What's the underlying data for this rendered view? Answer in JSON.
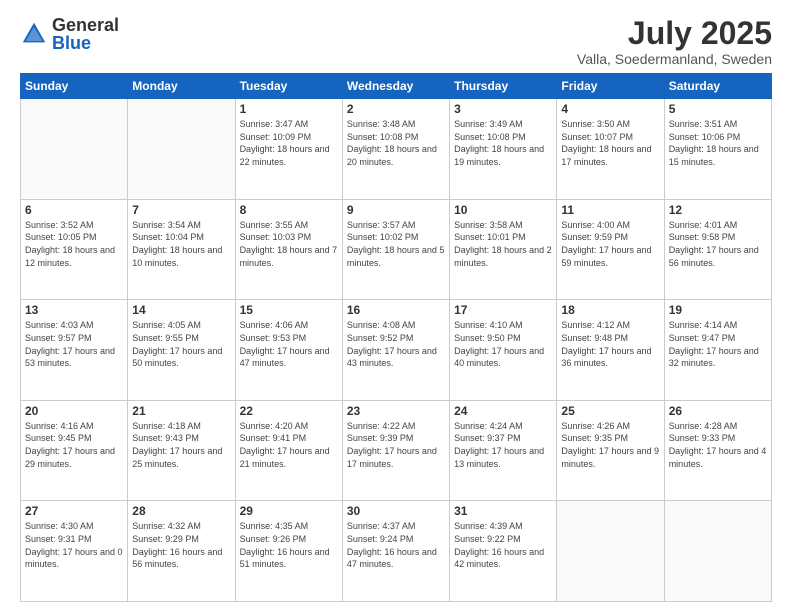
{
  "header": {
    "logo_general": "General",
    "logo_blue": "Blue",
    "month_title": "July 2025",
    "subtitle": "Valla, Soedermanland, Sweden"
  },
  "weekdays": [
    "Sunday",
    "Monday",
    "Tuesday",
    "Wednesday",
    "Thursday",
    "Friday",
    "Saturday"
  ],
  "weeks": [
    [
      {
        "day": "",
        "sunrise": "",
        "sunset": "",
        "daylight": ""
      },
      {
        "day": "",
        "sunrise": "",
        "sunset": "",
        "daylight": ""
      },
      {
        "day": "1",
        "sunrise": "Sunrise: 3:47 AM",
        "sunset": "Sunset: 10:09 PM",
        "daylight": "Daylight: 18 hours and 22 minutes."
      },
      {
        "day": "2",
        "sunrise": "Sunrise: 3:48 AM",
        "sunset": "Sunset: 10:08 PM",
        "daylight": "Daylight: 18 hours and 20 minutes."
      },
      {
        "day": "3",
        "sunrise": "Sunrise: 3:49 AM",
        "sunset": "Sunset: 10:08 PM",
        "daylight": "Daylight: 18 hours and 19 minutes."
      },
      {
        "day": "4",
        "sunrise": "Sunrise: 3:50 AM",
        "sunset": "Sunset: 10:07 PM",
        "daylight": "Daylight: 18 hours and 17 minutes."
      },
      {
        "day": "5",
        "sunrise": "Sunrise: 3:51 AM",
        "sunset": "Sunset: 10:06 PM",
        "daylight": "Daylight: 18 hours and 15 minutes."
      }
    ],
    [
      {
        "day": "6",
        "sunrise": "Sunrise: 3:52 AM",
        "sunset": "Sunset: 10:05 PM",
        "daylight": "Daylight: 18 hours and 12 minutes."
      },
      {
        "day": "7",
        "sunrise": "Sunrise: 3:54 AM",
        "sunset": "Sunset: 10:04 PM",
        "daylight": "Daylight: 18 hours and 10 minutes."
      },
      {
        "day": "8",
        "sunrise": "Sunrise: 3:55 AM",
        "sunset": "Sunset: 10:03 PM",
        "daylight": "Daylight: 18 hours and 7 minutes."
      },
      {
        "day": "9",
        "sunrise": "Sunrise: 3:57 AM",
        "sunset": "Sunset: 10:02 PM",
        "daylight": "Daylight: 18 hours and 5 minutes."
      },
      {
        "day": "10",
        "sunrise": "Sunrise: 3:58 AM",
        "sunset": "Sunset: 10:01 PM",
        "daylight": "Daylight: 18 hours and 2 minutes."
      },
      {
        "day": "11",
        "sunrise": "Sunrise: 4:00 AM",
        "sunset": "Sunset: 9:59 PM",
        "daylight": "Daylight: 17 hours and 59 minutes."
      },
      {
        "day": "12",
        "sunrise": "Sunrise: 4:01 AM",
        "sunset": "Sunset: 9:58 PM",
        "daylight": "Daylight: 17 hours and 56 minutes."
      }
    ],
    [
      {
        "day": "13",
        "sunrise": "Sunrise: 4:03 AM",
        "sunset": "Sunset: 9:57 PM",
        "daylight": "Daylight: 17 hours and 53 minutes."
      },
      {
        "day": "14",
        "sunrise": "Sunrise: 4:05 AM",
        "sunset": "Sunset: 9:55 PM",
        "daylight": "Daylight: 17 hours and 50 minutes."
      },
      {
        "day": "15",
        "sunrise": "Sunrise: 4:06 AM",
        "sunset": "Sunset: 9:53 PM",
        "daylight": "Daylight: 17 hours and 47 minutes."
      },
      {
        "day": "16",
        "sunrise": "Sunrise: 4:08 AM",
        "sunset": "Sunset: 9:52 PM",
        "daylight": "Daylight: 17 hours and 43 minutes."
      },
      {
        "day": "17",
        "sunrise": "Sunrise: 4:10 AM",
        "sunset": "Sunset: 9:50 PM",
        "daylight": "Daylight: 17 hours and 40 minutes."
      },
      {
        "day": "18",
        "sunrise": "Sunrise: 4:12 AM",
        "sunset": "Sunset: 9:48 PM",
        "daylight": "Daylight: 17 hours and 36 minutes."
      },
      {
        "day": "19",
        "sunrise": "Sunrise: 4:14 AM",
        "sunset": "Sunset: 9:47 PM",
        "daylight": "Daylight: 17 hours and 32 minutes."
      }
    ],
    [
      {
        "day": "20",
        "sunrise": "Sunrise: 4:16 AM",
        "sunset": "Sunset: 9:45 PM",
        "daylight": "Daylight: 17 hours and 29 minutes."
      },
      {
        "day": "21",
        "sunrise": "Sunrise: 4:18 AM",
        "sunset": "Sunset: 9:43 PM",
        "daylight": "Daylight: 17 hours and 25 minutes."
      },
      {
        "day": "22",
        "sunrise": "Sunrise: 4:20 AM",
        "sunset": "Sunset: 9:41 PM",
        "daylight": "Daylight: 17 hours and 21 minutes."
      },
      {
        "day": "23",
        "sunrise": "Sunrise: 4:22 AM",
        "sunset": "Sunset: 9:39 PM",
        "daylight": "Daylight: 17 hours and 17 minutes."
      },
      {
        "day": "24",
        "sunrise": "Sunrise: 4:24 AM",
        "sunset": "Sunset: 9:37 PM",
        "daylight": "Daylight: 17 hours and 13 minutes."
      },
      {
        "day": "25",
        "sunrise": "Sunrise: 4:26 AM",
        "sunset": "Sunset: 9:35 PM",
        "daylight": "Daylight: 17 hours and 9 minutes."
      },
      {
        "day": "26",
        "sunrise": "Sunrise: 4:28 AM",
        "sunset": "Sunset: 9:33 PM",
        "daylight": "Daylight: 17 hours and 4 minutes."
      }
    ],
    [
      {
        "day": "27",
        "sunrise": "Sunrise: 4:30 AM",
        "sunset": "Sunset: 9:31 PM",
        "daylight": "Daylight: 17 hours and 0 minutes."
      },
      {
        "day": "28",
        "sunrise": "Sunrise: 4:32 AM",
        "sunset": "Sunset: 9:29 PM",
        "daylight": "Daylight: 16 hours and 56 minutes."
      },
      {
        "day": "29",
        "sunrise": "Sunrise: 4:35 AM",
        "sunset": "Sunset: 9:26 PM",
        "daylight": "Daylight: 16 hours and 51 minutes."
      },
      {
        "day": "30",
        "sunrise": "Sunrise: 4:37 AM",
        "sunset": "Sunset: 9:24 PM",
        "daylight": "Daylight: 16 hours and 47 minutes."
      },
      {
        "day": "31",
        "sunrise": "Sunrise: 4:39 AM",
        "sunset": "Sunset: 9:22 PM",
        "daylight": "Daylight: 16 hours and 42 minutes."
      },
      {
        "day": "",
        "sunrise": "",
        "sunset": "",
        "daylight": ""
      },
      {
        "day": "",
        "sunrise": "",
        "sunset": "",
        "daylight": ""
      }
    ]
  ]
}
